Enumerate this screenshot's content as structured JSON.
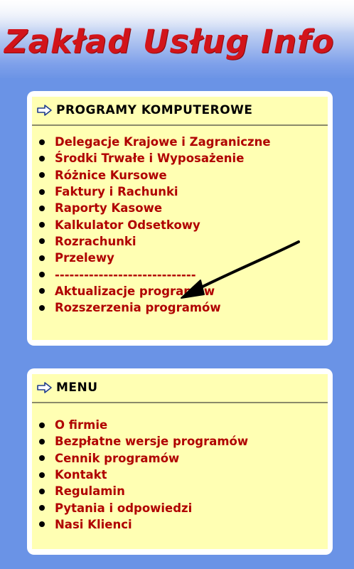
{
  "header": {
    "title": "Zakład Usług Info"
  },
  "programs_panel": {
    "title": "PROGRAMY KOMPUTEROWE",
    "items": [
      "Delegacje Krajowe i Zagraniczne",
      "Środki Trwałe i Wyposażenie",
      "Różnice Kursowe",
      "Faktury i Rachunki",
      "Raporty Kasowe",
      "Kalkulator Odsetkowy",
      "Rozrachunki",
      "Przelewy",
      "-----------------------------",
      "Aktualizacje programów",
      "Rozszerzenia programów"
    ]
  },
  "menu_panel": {
    "title": "MENU",
    "items": [
      "O firmie",
      "Bezpłatne wersje programów",
      "Cennik programów",
      "Kontakt",
      "Regulamin",
      "Pytania i odpowiedzi",
      "Nasi Klienci"
    ]
  },
  "colors": {
    "page_background": "#6a93e6",
    "title_red": "#d2141a",
    "panel_yellow": "#ffffb3",
    "link_red": "#b00000"
  },
  "icons": {
    "panel_header_icon": "arrow-right-outline-icon"
  }
}
